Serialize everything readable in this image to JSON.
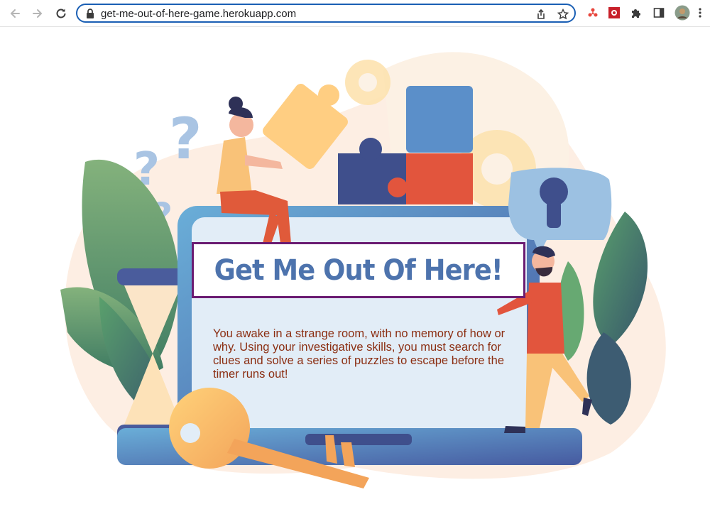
{
  "browser": {
    "url": "get-me-out-of-here-game.herokuapp.com",
    "icons": {
      "back": "arrow-left-icon",
      "forward": "arrow-right-icon",
      "reload": "reload-icon",
      "lock": "lock-icon",
      "share": "share-icon",
      "bookmark": "star-icon",
      "extension_1": "extension-icon",
      "extension_2": "extension-icon",
      "extensions": "puzzle-icon",
      "side_panel": "side-panel-icon",
      "profile": "avatar",
      "menu": "kebab-menu-icon"
    },
    "accent_color": "#1a5fb4"
  },
  "game": {
    "title": "Get Me Out Of Here!",
    "intro": "You awake in a strange room, with no memory of how or why. Using your investigative skills, you must search for clues and solve a series of puzzles to escape before the timer runs out!",
    "title_color": "#4d73ad",
    "title_border_color": "#6b1c72",
    "intro_color": "#8b2e12"
  }
}
